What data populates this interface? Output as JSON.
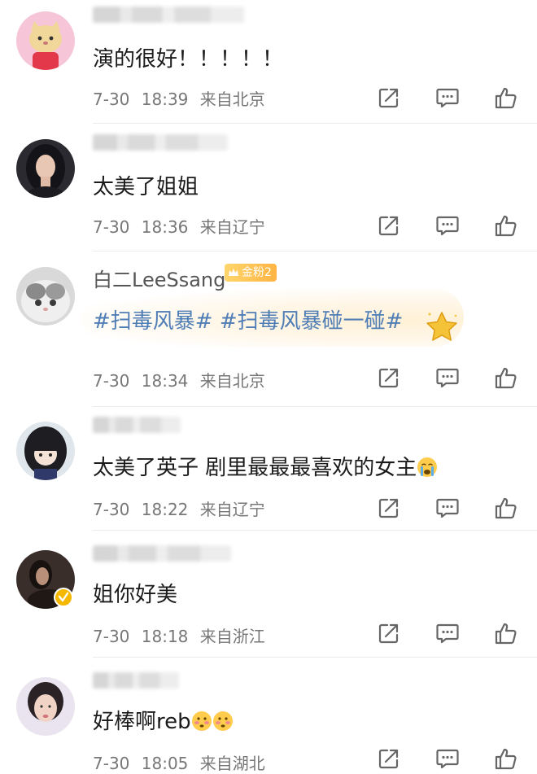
{
  "comments": [
    {
      "text": "演的很好！！！！！",
      "date": "7-30",
      "time": "18:39",
      "location": "来自北京",
      "avatar": "cartoon-cat-avatar"
    },
    {
      "text": "太美了姐姐",
      "date": "7-30",
      "time": "18:36",
      "location": "来自辽宁",
      "avatar": "woman-portrait-avatar"
    },
    {
      "username": "白二LeeSsang",
      "fan_badge": "金粉2",
      "topics": "#扫毒风暴# #扫毒风暴碰一碰#",
      "date": "7-30",
      "time": "18:34",
      "location": "来自北京",
      "avatar": "cat-photo-avatar"
    },
    {
      "text": "太美了英子 剧里最最最喜欢的女主",
      "date": "7-30",
      "time": "18:22",
      "location": "来自辽宁",
      "avatar": "anime-girl-avatar"
    },
    {
      "text": "姐你好美",
      "date": "7-30",
      "time": "18:18",
      "location": "来自浙江",
      "avatar": "dim-portrait-avatar"
    },
    {
      "text": "好棒啊reb",
      "date": "7-30",
      "time": "18:05",
      "location": "来自湖北",
      "avatar": "woman-face-avatar"
    }
  ],
  "icons": {
    "repost": "share-box-icon",
    "comment": "comment-bubble-icon",
    "like": "thumbs-up-icon",
    "verified": "verified-badge-icon"
  },
  "colors": {
    "topic": "#4f7db5",
    "meta": "#777777",
    "fan_badge": "#ffb443",
    "verified": "#f5b800"
  }
}
